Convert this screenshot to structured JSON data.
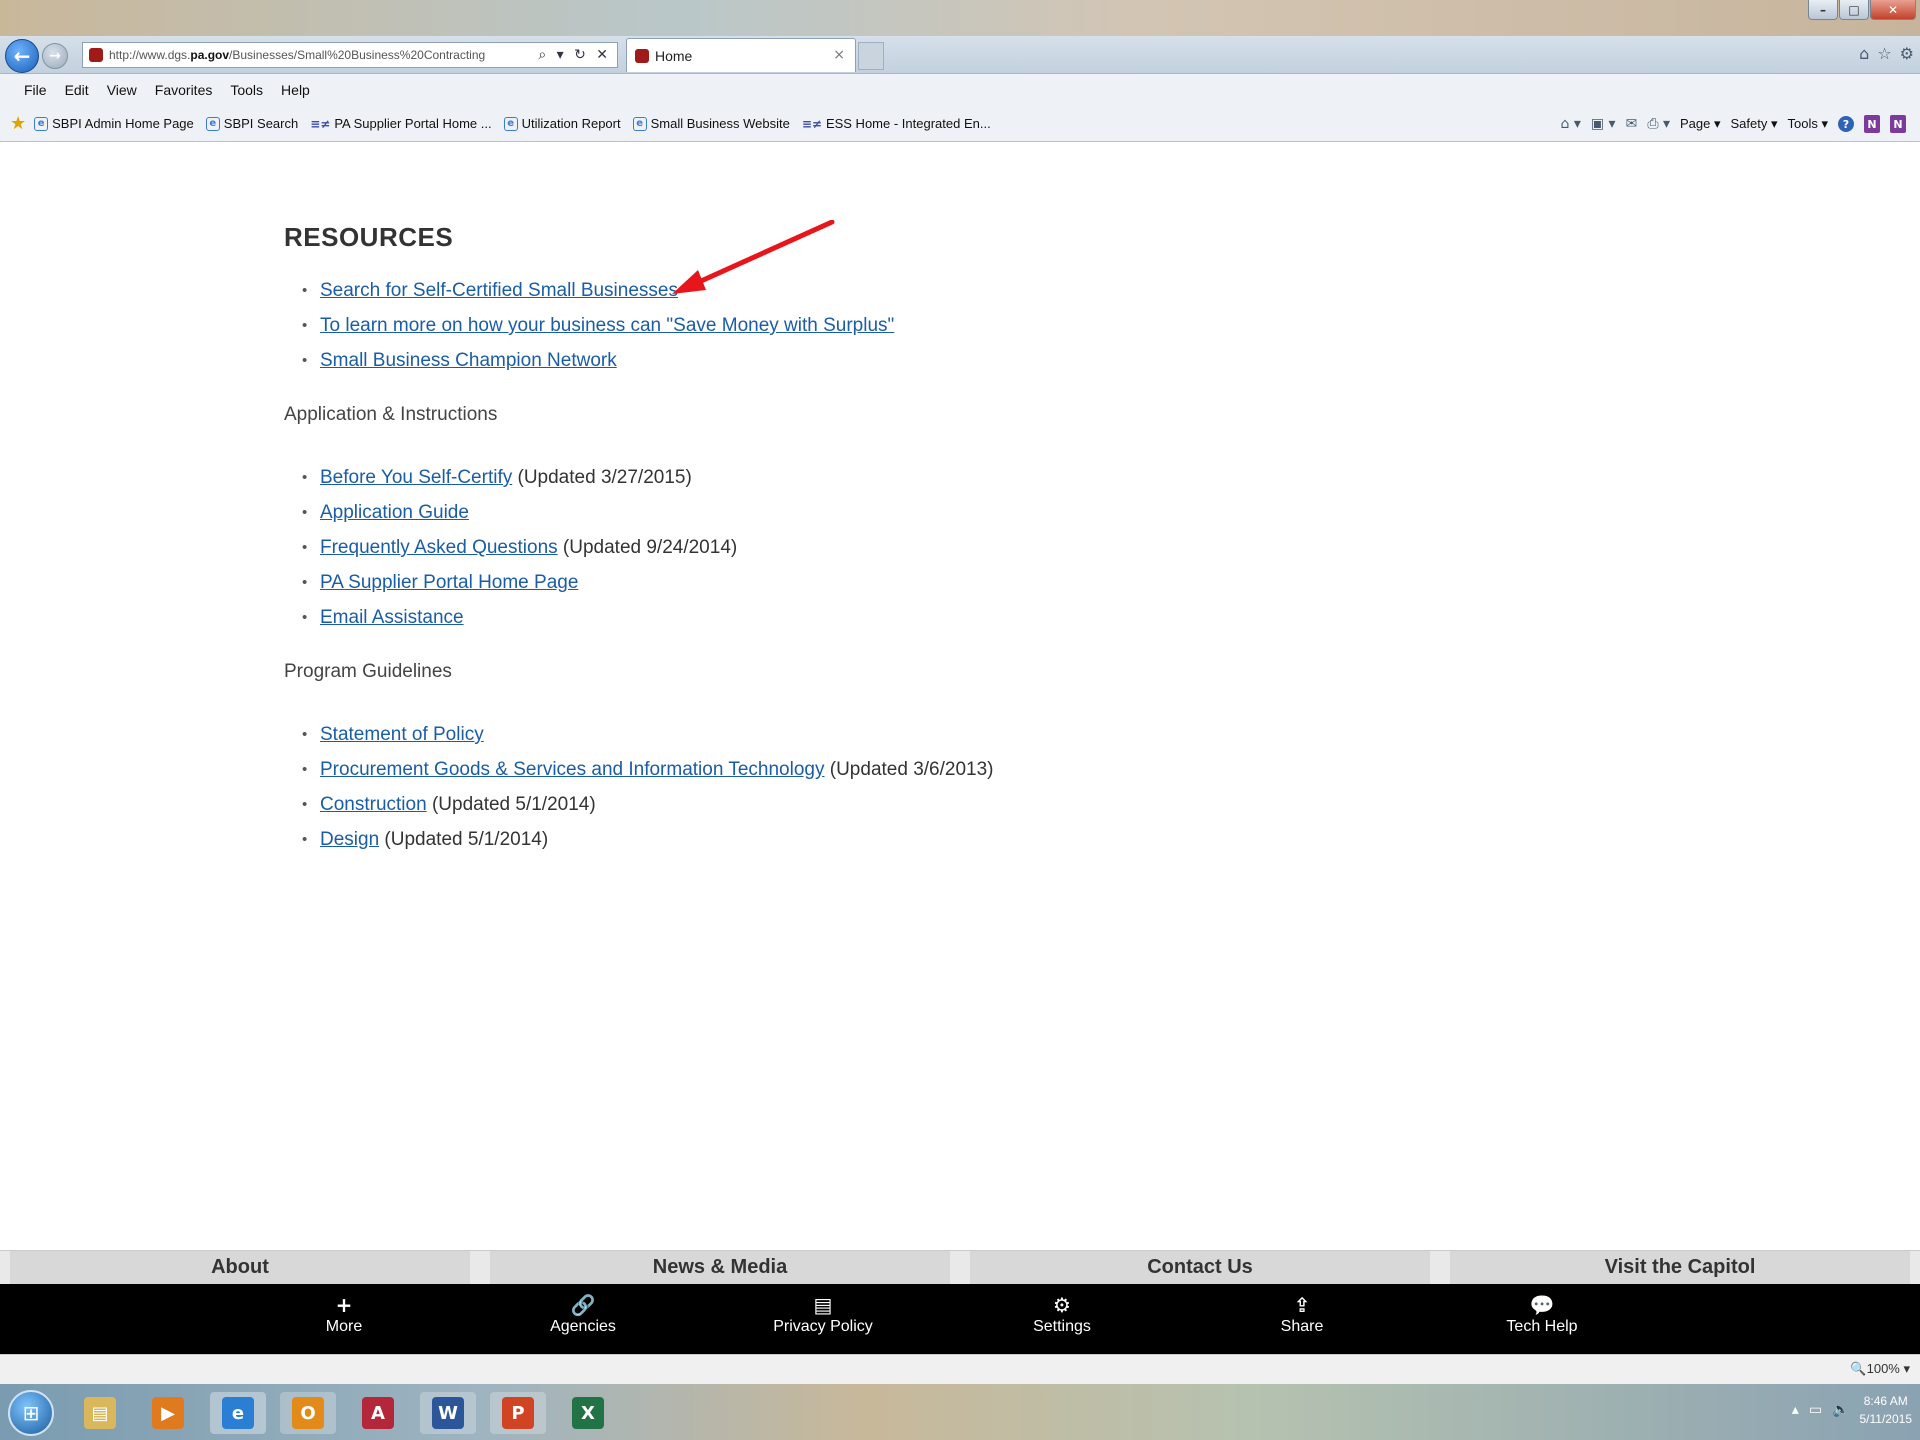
{
  "browser": {
    "address_prefix": "http://www.dgs.",
    "address_domain": "pa.gov",
    "address_path": "/Businesses/Small%20Business%20Contracting",
    "address_tools": "⌕ ▾ ↻ ✕",
    "tab_title": "Home",
    "tab_close": "×",
    "menu": [
      "File",
      "Edit",
      "View",
      "Favorites",
      "Tools",
      "Help"
    ],
    "favorites": [
      {
        "label": "SBPI Admin Home Page",
        "icon": "ie"
      },
      {
        "label": "SBPI Search",
        "icon": "ie"
      },
      {
        "label": "PA Supplier Portal Home ...",
        "icon": "esp"
      },
      {
        "label": "Utilization Report",
        "icon": "ie"
      },
      {
        "label": "Small Business Website",
        "icon": "ie"
      },
      {
        "label": "ESS Home - Integrated En...",
        "icon": "esp"
      }
    ],
    "commands": {
      "page": "Page ▾",
      "safety": "Safety ▾",
      "tools": "Tools ▾",
      "help_icon": "?",
      "onenote_icon": "N"
    }
  },
  "content": {
    "resources_heading": "RESOURCES",
    "resources": [
      {
        "link": "Search for Self-Certified Small Businesses",
        "note": ""
      },
      {
        "link": "To learn more on how your business can \"Save Money with Surplus\"",
        "note": ""
      },
      {
        "link": "Small Business Champion Network",
        "note": ""
      }
    ],
    "application_heading": "Application & Instructions",
    "application": [
      {
        "link": "Before You Self-Certify",
        "note": " (Updated 3/27/2015)"
      },
      {
        "link": "Application Guide",
        "note": ""
      },
      {
        "link": "Frequently Asked Questions",
        "note": " (Updated 9/24/2014)"
      },
      {
        "link": "PA Supplier Portal Home Page",
        "note": ""
      },
      {
        "link": "Email Assistance",
        "note": ""
      }
    ],
    "guidelines_heading": "Program Guidelines",
    "guidelines": [
      {
        "link": "Statement of Policy",
        "note": ""
      },
      {
        "link": "Procurement Goods & Services and Information Technology",
        "note": " (Updated 3/6/2013)"
      },
      {
        "link": "Construction",
        "note": " (Updated 5/1/2014)"
      },
      {
        "link": "Design",
        "note": " (Updated 5/1/2014)"
      }
    ]
  },
  "footer": {
    "tabs": [
      "About",
      "News & Media",
      "Contact Us",
      "Visit the Capitol"
    ],
    "bar": [
      {
        "label": "More",
        "icon": "+"
      },
      {
        "label": "Agencies",
        "icon": "🔗"
      },
      {
        "label": "Privacy Policy",
        "icon": "▤"
      },
      {
        "label": "Settings",
        "icon": "⚙"
      },
      {
        "label": "Share",
        "icon": "⇪"
      },
      {
        "label": "Tech Help",
        "icon": "💬"
      }
    ]
  },
  "status": {
    "zoom": "🔍100% ▾"
  },
  "taskbar": {
    "apps": [
      {
        "name": "explorer",
        "glyph": "▤",
        "color": "#d9b75a"
      },
      {
        "name": "media-player",
        "glyph": "▶",
        "color": "#e07a1f"
      },
      {
        "name": "internet-explorer",
        "glyph": "e",
        "color": "#2a7fd4"
      },
      {
        "name": "outlook",
        "glyph": "O",
        "color": "#e38b1a"
      },
      {
        "name": "access",
        "glyph": "A",
        "color": "#b4263a"
      },
      {
        "name": "word",
        "glyph": "W",
        "color": "#2b579a"
      },
      {
        "name": "powerpoint",
        "glyph": "P",
        "color": "#d04423"
      },
      {
        "name": "excel",
        "glyph": "X",
        "color": "#217346"
      }
    ],
    "time": "8:46 AM",
    "date": "5/11/2015"
  },
  "colors": {
    "link": "#1a5da6",
    "arrow": "#e8161b",
    "footer_bg": "#000000"
  }
}
